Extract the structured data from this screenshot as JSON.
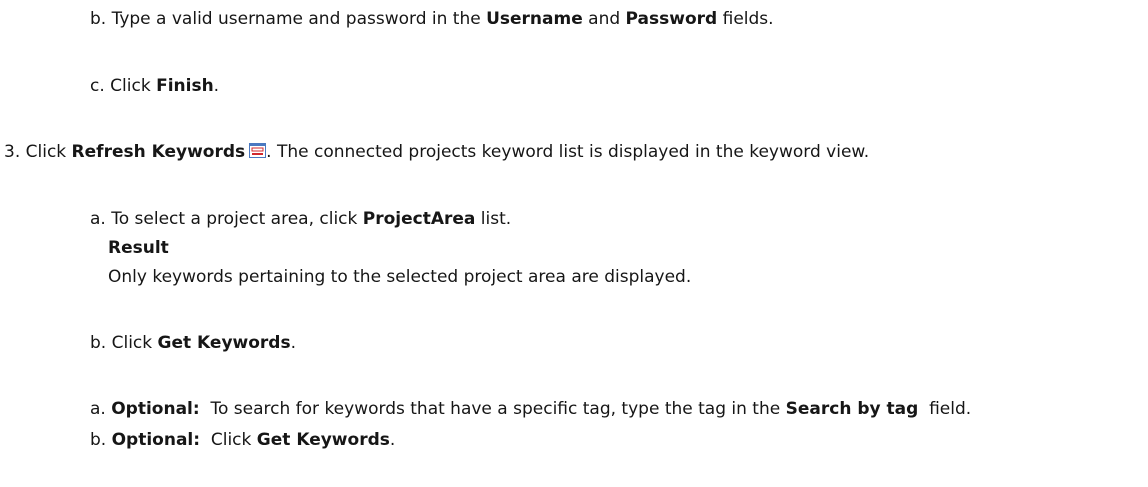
{
  "steps": {
    "b1": {
      "prefix": "b. Type a valid username and password in the ",
      "username": "Username",
      "and": " and ",
      "password": "Password",
      "suffix": " fields."
    },
    "c1": {
      "prefix": "c. Click ",
      "finish": "Finish",
      "suffix": "."
    },
    "s3": {
      "prefix": "3. Click ",
      "refresh": "Refresh Keywords",
      "suffix": ". The connected projects keyword list is displayed in the keyword view.",
      "icon": "refresh-keywords-icon"
    },
    "a2": {
      "prefix": "a. To select a project area, click ",
      "projectarea": "ProjectArea",
      "suffix": " list."
    },
    "result_label": "Result",
    "result_text": "Only keywords pertaining to the selected project area are displayed.",
    "b2": {
      "prefix": "b. Click ",
      "get": "Get Keywords",
      "suffix": "."
    },
    "a3": {
      "prefix": "a. ",
      "optional": "Optional:",
      "mid": "  To search for keywords that have a specific tag, type the tag in the ",
      "search": "Search by tag",
      "suffix": "  field."
    },
    "b3": {
      "prefix": "b. ",
      "optional": "Optional:",
      "mid": "  Click ",
      "get": "Get Keywords",
      "suffix": "."
    }
  },
  "colors": {
    "icon_red": "#d0282e",
    "icon_blue": "#4a78c0"
  }
}
